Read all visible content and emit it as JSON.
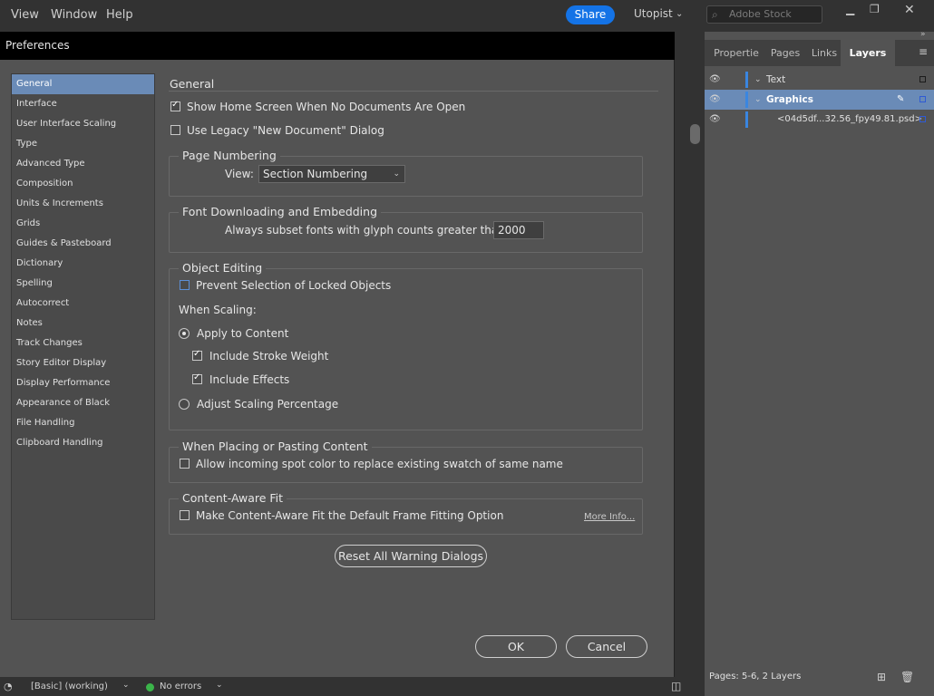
{
  "menubar": {
    "items": [
      "View",
      "Window",
      "Help"
    ],
    "share_label": "Share",
    "workspace": "Utopist",
    "stock_placeholder": "Adobe Stock"
  },
  "dialog": {
    "title": "Preferences",
    "categories": [
      "General",
      "Interface",
      "User Interface Scaling",
      "Type",
      "Advanced Type",
      "Composition",
      "Units & Increments",
      "Grids",
      "Guides & Pasteboard",
      "Dictionary",
      "Spelling",
      "Autocorrect",
      "Notes",
      "Track Changes",
      "Story Editor Display",
      "Display Performance",
      "Appearance of Black",
      "File Handling",
      "Clipboard Handling"
    ],
    "selected_category": "General",
    "section_title": "General",
    "show_home_label": "Show Home Screen When No Documents Are Open",
    "legacy_label": "Use Legacy \"New Document\" Dialog",
    "page_numbering": {
      "legend": "Page Numbering",
      "view_label": "View:",
      "view_value": "Section Numbering"
    },
    "font_embed": {
      "legend": "Font Downloading and Embedding",
      "subset_label": "Always subset fonts with glyph counts greater than:",
      "subset_value": "2000"
    },
    "object_editing": {
      "legend": "Object Editing",
      "prevent_label": "Prevent Selection of Locked Objects",
      "when_scaling": "When Scaling:",
      "apply_label": "Apply to Content",
      "stroke_label": "Include Stroke Weight",
      "effects_label": "Include Effects",
      "adjust_label": "Adjust Scaling Percentage"
    },
    "placing": {
      "legend": "When Placing or Pasting Content",
      "spot_label": "Allow incoming spot color to replace existing swatch of same name"
    },
    "content_aware": {
      "legend": "Content-Aware Fit",
      "default_label": "Make Content-Aware Fit the Default Frame Fitting Option",
      "more_info": "More Info..."
    },
    "reset_label": "Reset All Warning Dialogs",
    "ok_label": "OK",
    "cancel_label": "Cancel"
  },
  "layers_panel": {
    "tabs": [
      "Propertie",
      "Pages",
      "Links",
      "Layers"
    ],
    "active_tab": "Layers",
    "layers": [
      {
        "name": "Text"
      },
      {
        "name": "Graphics"
      },
      {
        "name": "<04d5df...32.56_fpy49.81.psd>"
      }
    ],
    "footer": "Pages: 5-6, 2 Layers"
  },
  "statusbar": {
    "preset": "[Basic] (working)",
    "errors": "No errors"
  },
  "colors": {
    "accent": "#1473e6",
    "selection": "#6a8bb7",
    "layer_color": "#3a86e0",
    "dialog_bg": "#535353"
  }
}
